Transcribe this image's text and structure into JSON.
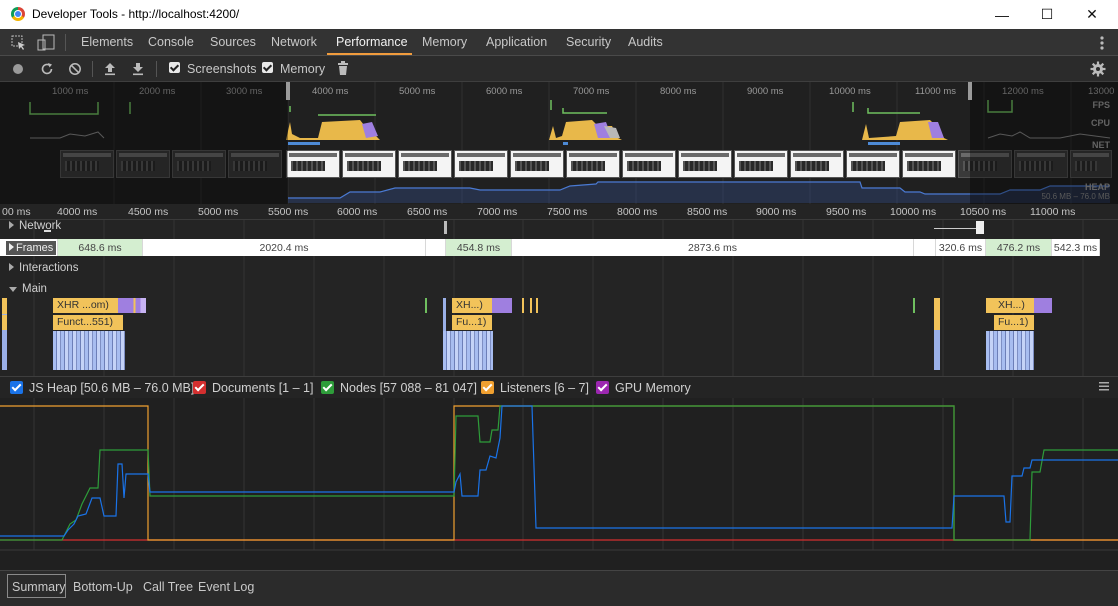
{
  "window": {
    "title": "Developer Tools - http://localhost:4200/",
    "minimize": "—",
    "maximize": "☐",
    "close": "✕"
  },
  "tabs": [
    "Elements",
    "Console",
    "Sources",
    "Network",
    "Performance",
    "Memory",
    "Application",
    "Security",
    "Audits"
  ],
  "active_tab": "Performance",
  "toolbar": {
    "screenshots_label": "Screenshots",
    "screenshots_checked": true,
    "memory_label": "Memory",
    "memory_checked": true
  },
  "overview": {
    "ticks": [
      "1000 ms",
      "2000 ms",
      "3000 ms",
      "4000 ms",
      "5000 ms",
      "6000 ms",
      "7000 ms",
      "8000 ms",
      "9000 ms",
      "10000 ms",
      "11000 ms",
      "12000 ms",
      "13000"
    ],
    "labels": {
      "fps": "FPS",
      "cpu": "CPU",
      "net": "NET",
      "heap": "HEAP"
    },
    "heap_range": "50.6 MB – 76.0 MB"
  },
  "ruler": [
    "00 ms",
    "4000 ms",
    "4500 ms",
    "5000 ms",
    "5500 ms",
    "6000 ms",
    "6500 ms",
    "7000 ms",
    "7500 ms",
    "8000 ms",
    "8500 ms",
    "9000 ms",
    "9500 ms",
    "10000 ms",
    "10500 ms",
    "11000 ms"
  ],
  "tracks": {
    "network": "Network",
    "frames": "Frames",
    "interactions": "Interactions",
    "main": "Main"
  },
  "frames": [
    "648.6 ms",
    "2020.4 ms",
    "454.8 ms",
    "2873.6 ms",
    "320.6 ms",
    "476.2 ms",
    "542.3 ms"
  ],
  "main_events": {
    "xhr1": "XHR ...om)",
    "func1": "Funct...551)",
    "xhr2": "XH...)",
    "func2": "Fu...1)",
    "xhr3": "XH...)",
    "func3": "Fu...1)"
  },
  "memory_legend": {
    "js_heap": "JS Heap [50.6 MB – 76.0 MB]",
    "documents": "Documents [1 – 1]",
    "nodes": "Nodes [57 088 – 81 047]",
    "listeners": "Listeners [6 – 7]",
    "gpu": "GPU Memory"
  },
  "colors": {
    "js_heap": "#1a73e8",
    "documents": "#d32f2f",
    "nodes": "#2e9d3a",
    "listeners": "#f0a030",
    "gpu": "#9c27b0",
    "accent": "#f19c3d"
  },
  "bottom_tabs": [
    "Summary",
    "Bottom-Up",
    "Call Tree",
    "Event Log"
  ],
  "active_bottom_tab": "Summary"
}
